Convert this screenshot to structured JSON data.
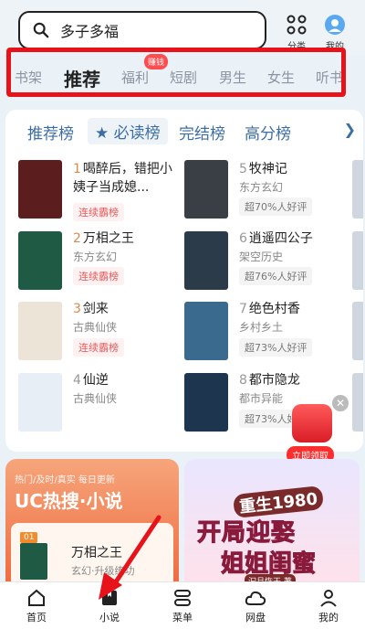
{
  "search": {
    "query": "多子多福"
  },
  "header": {
    "category_label": "分类",
    "mine_label": "我的"
  },
  "tabs": {
    "items": [
      "书架",
      "推荐",
      "福利",
      "短剧",
      "男生",
      "女生",
      "听书"
    ],
    "badge": "赚钱"
  },
  "subtabs": [
    "推荐榜",
    "★ 必读榜",
    "完结榜",
    "高分榜"
  ],
  "books": [
    {
      "rank": "1",
      "title": "喝醉后，错把小姨子当成媳...",
      "tag": "连续霸榜",
      "cover_color": "#5b1d1d"
    },
    {
      "rank": "2",
      "title": "万相之王",
      "cat": "东方玄幻",
      "tag": "连续霸榜",
      "cover_color": "#1f5a45"
    },
    {
      "rank": "3",
      "title": "剑来",
      "cat": "古典仙侠",
      "tag": "连续霸榜",
      "cover_color": "#ece4d6"
    },
    {
      "rank": "4",
      "title": "仙逆",
      "cat": "古典仙侠",
      "cover_color": "#e7eef6"
    },
    {
      "rank": "5",
      "title": "牧神记",
      "cat": "东方玄幻",
      "tag": "超70%人好评",
      "cover_color": "#3a3f46"
    },
    {
      "rank": "6",
      "title": "逍遥四公子",
      "cat": "架空历史",
      "tag": "超76%人好评",
      "cover_color": "#2c3b4a"
    },
    {
      "rank": "7",
      "title": "绝色村香",
      "cat": "乡村乡土",
      "tag": "超73%人好评",
      "cover_color": "#3b6a8f"
    },
    {
      "rank": "8",
      "title": "都市隐龙",
      "cat": "都市异能",
      "tag": "超73%人好评",
      "cover_color": "#1e3550"
    }
  ],
  "promo": {
    "label": "立即领取"
  },
  "banner_left": {
    "small": "热门/及时/真实 每日更新",
    "big": "UC热搜·小说",
    "num": "01",
    "book_title": "万相之王",
    "book_sub": "玄幻·升级练功"
  },
  "banner_right": {
    "line1": "重生1980",
    "line2": "开局迎娶",
    "line3": "姐姐闺蜜",
    "line4": "汩月恢天 著"
  },
  "nav": [
    "首页",
    "小说",
    "菜单",
    "网盘",
    "我的"
  ],
  "colors": {
    "highlight": "#e8121b",
    "accent": "#3c6ea6",
    "tag_red": "#e85a5a"
  }
}
